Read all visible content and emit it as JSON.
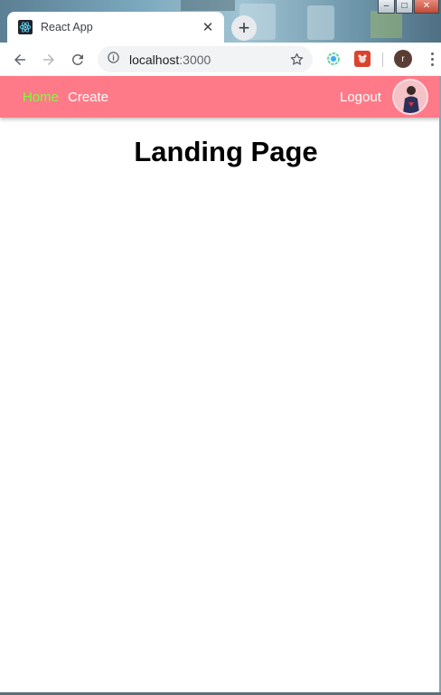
{
  "window": {
    "controls": {
      "minimize": "–",
      "maximize": "□",
      "close": "✕"
    }
  },
  "browser": {
    "tab": {
      "title": "React App",
      "favicon": "react-icon",
      "close": "✕"
    },
    "new_tab": "+",
    "address": {
      "host": "localhost",
      "port": ":3000",
      "icon": "info-icon"
    },
    "profile_initial": "r",
    "icons": [
      "back-arrow-icon",
      "forward-arrow-icon",
      "reload-icon",
      "star-icon",
      "extension-icon",
      "menu-icon"
    ]
  },
  "navbar": {
    "background": "#ff7a88",
    "links": [
      {
        "label": "Home",
        "active": true,
        "color": "#7cff3a"
      },
      {
        "label": "Create",
        "active": false,
        "color": "#ffffff"
      }
    ],
    "logout_label": "Logout"
  },
  "main": {
    "title": "Landing Page"
  }
}
